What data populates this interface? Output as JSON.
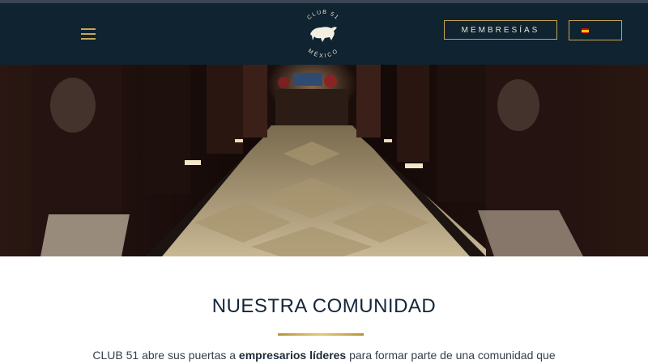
{
  "header": {
    "menu_icon": "hamburger-menu-icon",
    "logo_text_top": "CLUB 51",
    "logo_text_bottom": "MÉXICO",
    "membership_label": "MEMBRESÍAS",
    "language_flag": "spain-flag-icon"
  },
  "hero": {
    "image": "hotel-corridor-photo"
  },
  "community": {
    "title": "NUESTRA COMUNIDAD",
    "intro_part1": "CLUB 51 abre sus puertas a ",
    "intro_bold": "empresarios líderes",
    "intro_part2": " para formar parte de una comunidad que"
  },
  "colors": {
    "header_bg": "#0f2330",
    "gold": "#c9a552",
    "title": "#13263a"
  }
}
